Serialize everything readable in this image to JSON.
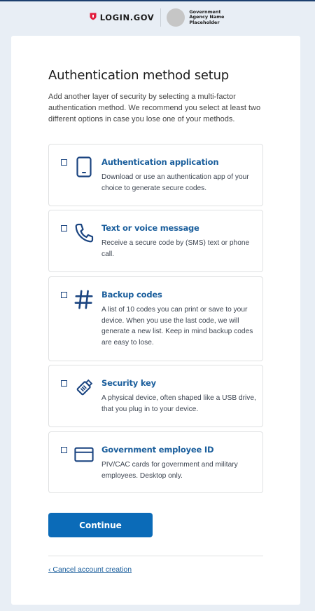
{
  "header": {
    "logo_text": "LOGIN.GOV",
    "agency_name": "Government Agency Name Placeholder"
  },
  "page": {
    "title": "Authentication method setup",
    "intro": "Add another layer of security by selecting a multi-factor authentication method. We recommend you select at least two different options in case you lose one of your methods."
  },
  "options": [
    {
      "title": "Authentication application",
      "description": "Download or use an authentication app of your choice to generate secure codes.",
      "icon": "phone-device-icon",
      "checked": false
    },
    {
      "title": "Text or voice message",
      "description": "Receive a secure code by (SMS) text or phone call.",
      "icon": "phone-handset-icon",
      "checked": false
    },
    {
      "title": "Backup codes",
      "description": "A list of 10 codes you can print or save to your device. When you use the last code, we will generate a new list. Keep in mind backup codes are easy to lose.",
      "icon": "hashtag-icon",
      "checked": false
    },
    {
      "title": "Security key",
      "description": "A physical device, often shaped like a USB drive, that you plug in to your device.",
      "icon": "security-key-icon",
      "checked": false
    },
    {
      "title": "Government employee ID",
      "description": "PIV/CAC cards for government and military employees. Desktop only.",
      "icon": "id-card-icon",
      "checked": false
    }
  ],
  "actions": {
    "continue_label": "Continue",
    "cancel_label": "‹ Cancel account creation"
  },
  "colors": {
    "accent": "#0b6bb8",
    "link": "#1a5e9c",
    "page_background": "#e8eef5",
    "brand_red": "#e21c3d"
  }
}
